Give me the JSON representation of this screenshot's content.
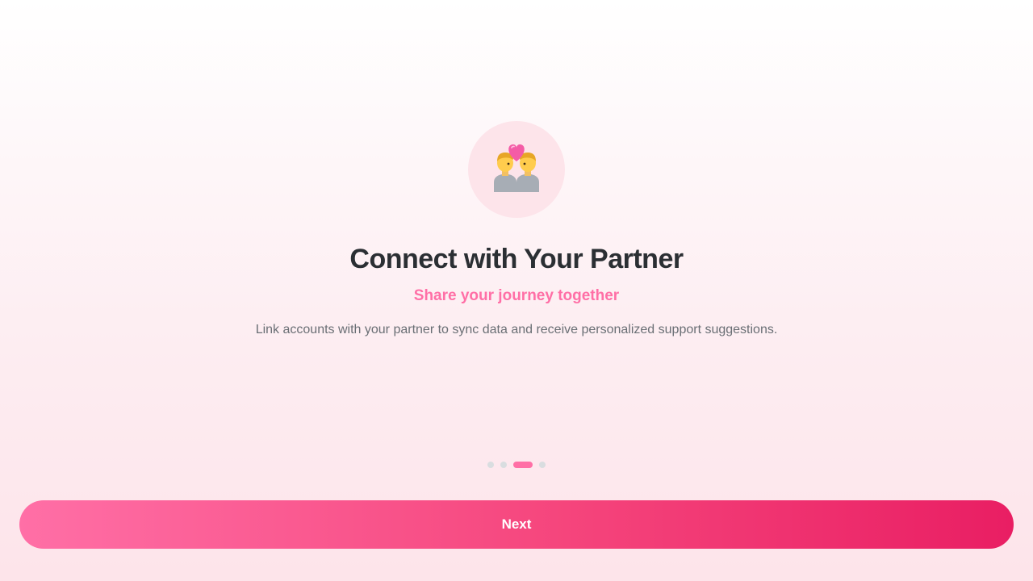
{
  "hero": {
    "icon": "couple-with-heart-icon"
  },
  "content": {
    "title": "Connect with Your Partner",
    "subtitle": "Share your journey together",
    "description": "Link accounts with your partner to sync data and receive personalized support suggestions."
  },
  "pagination": {
    "total": 4,
    "current": 3
  },
  "actions": {
    "next_label": "Next"
  },
  "colors": {
    "accent": "#ff6fa6",
    "button_end": "#e91e63",
    "title": "#2b2f33",
    "body_text": "#6a6f75",
    "inactive_dot": "#d9dde0"
  }
}
